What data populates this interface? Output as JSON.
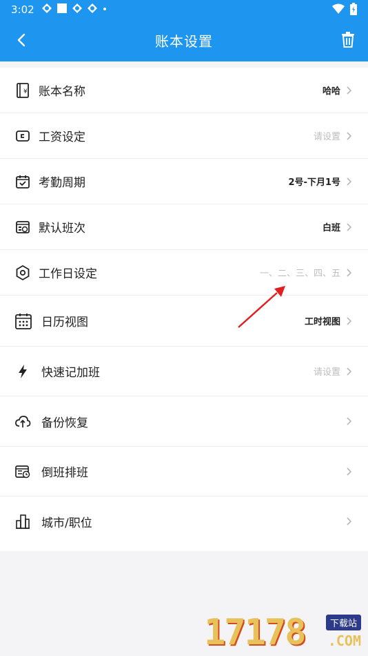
{
  "status_bar": {
    "time": "3:02"
  },
  "header": {
    "title": "账本设置"
  },
  "rows": [
    {
      "label": "账本名称",
      "value": "哈哈",
      "muted": false
    },
    {
      "label": "工资设定",
      "value": "请设置",
      "muted": true
    },
    {
      "label": "考勤周期",
      "value": "2号-下月1号",
      "muted": false
    },
    {
      "label": "默认班次",
      "value": "白班",
      "muted": false
    },
    {
      "label": "工作日设定",
      "value": "一、二、三、四、五",
      "muted": true
    },
    {
      "label": "日历视图",
      "value": "工时视图",
      "muted": false
    },
    {
      "label": "快速记加班",
      "value": "请设置",
      "muted": true
    },
    {
      "label": "备份恢复",
      "value": "",
      "muted": false
    },
    {
      "label": "倒班排班",
      "value": "",
      "muted": false
    },
    {
      "label": "城市/职位",
      "value": "",
      "muted": false
    }
  ],
  "icons": {
    "back": "back-arrow-icon",
    "trash": "trash-icon",
    "row_icons": [
      "notebook-icon",
      "wallet-icon",
      "calendar-check-icon",
      "shift-icon",
      "hexagon-gear-icon",
      "calendar-grid-icon",
      "lightning-icon",
      "cloud-upload-icon",
      "schedule-icon",
      "city-icon"
    ]
  },
  "colors": {
    "header": "#1e96f0",
    "text": "#222222",
    "muted": "#bdbdbd",
    "annotation_arrow": "#e02020"
  },
  "watermark": {
    "number": "17178",
    "tag": "下载站",
    "suffix": ".COM"
  }
}
